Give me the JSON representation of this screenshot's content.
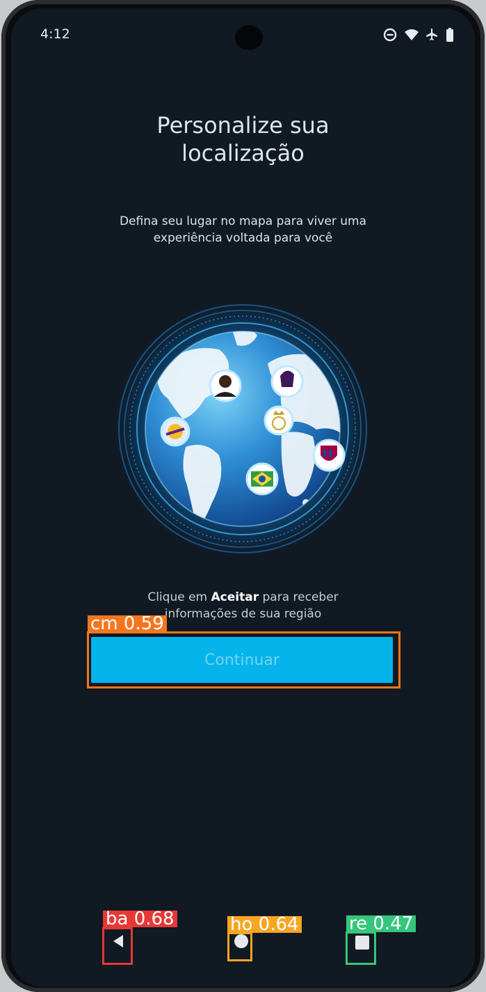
{
  "status_bar": {
    "time": "4:12"
  },
  "header": {
    "title_line1": "Personalize sua",
    "title_line2": "localização",
    "subtitle_line1": "Defina seu lugar no mapa para viver uma",
    "subtitle_line2": "experiência voltada para você"
  },
  "illustration": {
    "markers": [
      "player-avatar-icon",
      "premier-league-icon",
      "real-madrid-icon",
      "lakers-icon",
      "barcelona-icon",
      "brazil-flag-icon"
    ]
  },
  "info": {
    "prefix": "Clique em ",
    "highlight": "Aceitar",
    "suffix": " para receber",
    "line2": "informações de sua região"
  },
  "actions": {
    "continue_label": "Continuar"
  },
  "detections": {
    "continue": "cm 0.59",
    "back": "ba 0.68",
    "home": "ho 0.64",
    "recents": "re 0.47"
  },
  "colors": {
    "background": "#111922",
    "accent": "#04b4ea",
    "box_orange": "#f5761f",
    "box_red": "#e53935",
    "box_amber": "#f6a623",
    "box_green": "#34c77b"
  }
}
